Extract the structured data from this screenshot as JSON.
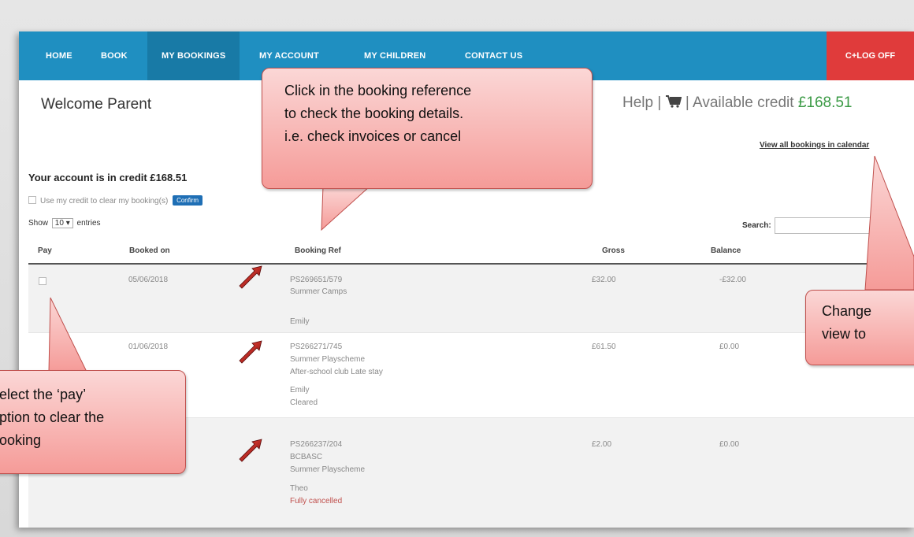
{
  "nav": {
    "items": [
      "HOME",
      "BOOK",
      "MY BOOKINGS",
      "MY ACCOUNT",
      "MY CHILDREN",
      "CONTACT US"
    ],
    "logoff": "C+LOG OFF",
    "active": "MY BOOKINGS",
    "colors": {
      "bar": "#1f8fc1",
      "active": "#187aa6",
      "logoff": "#e03b3b"
    }
  },
  "header": {
    "welcome": "Welcome Parent",
    "help": "Help |",
    "cart_icon": "cart-icon",
    "available_label": "| Available credit",
    "available_amount": "£168.51",
    "calendar_link": "View all bookings in calendar"
  },
  "account": {
    "status": "Your account is in credit £168.51",
    "use_credit_label": "Use my credit to clear my booking(s)",
    "confirm_label": "Confirm"
  },
  "table_controls": {
    "show_label": "Show",
    "entries_value": "10",
    "entries_label": "entries",
    "search_label": "Search:"
  },
  "table": {
    "columns": [
      "Pay",
      "Booked on",
      "Booking Ref",
      "Gross",
      "Balance"
    ],
    "rows": [
      {
        "booked_on": "05/06/2018",
        "ref": "PS269651/579",
        "details": [
          "Summer Camps",
          "Emily"
        ],
        "status": "",
        "gross": "£32.00",
        "balance": "-£32.00"
      },
      {
        "booked_on": "01/06/2018",
        "ref": "PS266271/745",
        "details": [
          "Summer Playscheme",
          "After-school club Late stay",
          "Emily"
        ],
        "status": "Cleared",
        "gross": "£61.50",
        "balance": "£0.00"
      },
      {
        "booked_on": "",
        "ref": "PS266237/204",
        "details": [
          "BCBASC",
          "Summer Playscheme",
          "Theo"
        ],
        "status": "Fully cancelled",
        "gross": "£2.00",
        "balance": "£0.00"
      }
    ]
  },
  "callouts": {
    "booking_ref": [
      "Click in the booking reference",
      "to check the booking details.",
      "i.e. check invoices or cancel"
    ],
    "pay": [
      "elect the ‘pay’",
      "ption to clear the",
      "ooking"
    ],
    "calendar": [
      "Change",
      "view to"
    ]
  },
  "accent_colors": {
    "credit": "#3a9a44",
    "cancelled": "#c0504d",
    "callout_border": "#c0504d"
  }
}
